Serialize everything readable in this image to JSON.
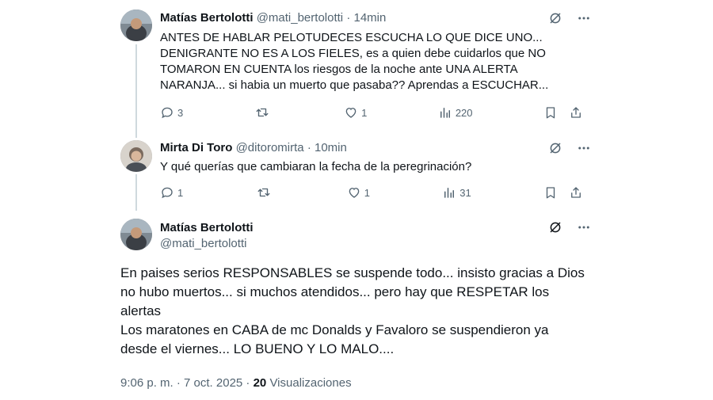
{
  "tweets": [
    {
      "name": "Matías Bertolotti",
      "handle": "@mati_bertolotti",
      "separator": "·",
      "time": "14min",
      "text": "ANTES DE HABLAR PELOTUDECES ESCUCHA LO QUE DICE UNO... DENIGRANTE NO ES A LOS FIELES, es a quien debe cuidarlos que NO TOMARON EN CUENTA los riesgos de la noche ante UNA ALERTA NARANJA... si habia un muerto que pasaba?? Aprendas a ESCUCHAR...",
      "replies": "3",
      "retweets": "",
      "likes": "1",
      "views": "220"
    },
    {
      "name": "Mirta Di Toro",
      "handle": "@ditoromirta",
      "separator": "·",
      "time": "10min",
      "text": "Y qué querías que cambiaran la fecha de la peregrinación?",
      "replies": "1",
      "retweets": "",
      "likes": "1",
      "views": "31"
    }
  ],
  "main_tweet": {
    "name": "Matías Bertolotti",
    "handle": "@mati_bertolotti",
    "paragraphs": [
      "En paises serios RESPONSABLES se suspende todo... insisto gracias a Dios no hubo muertos... si muchos atendidos... pero hay que RESPETAR los alertas",
      "Los maratones en CABA de mc Donalds y Favaloro se suspendieron ya desde el viernes... LO BUENO Y LO MALO...."
    ],
    "timestamp": "9:06 p. m. · 7 oct. 2025 · ",
    "views_count": "20",
    "views_label": " Visualizaciones"
  },
  "icons": {
    "grok": "grok-icon",
    "more": "more-icon",
    "reply": "reply-icon",
    "retweet": "retweet-icon",
    "like": "like-icon",
    "views": "views-icon",
    "bookmark": "bookmark-icon",
    "share": "share-icon"
  },
  "colors": {
    "text": "#0f1419",
    "secondary": "#536471",
    "thread_line": "#cfd9de"
  }
}
